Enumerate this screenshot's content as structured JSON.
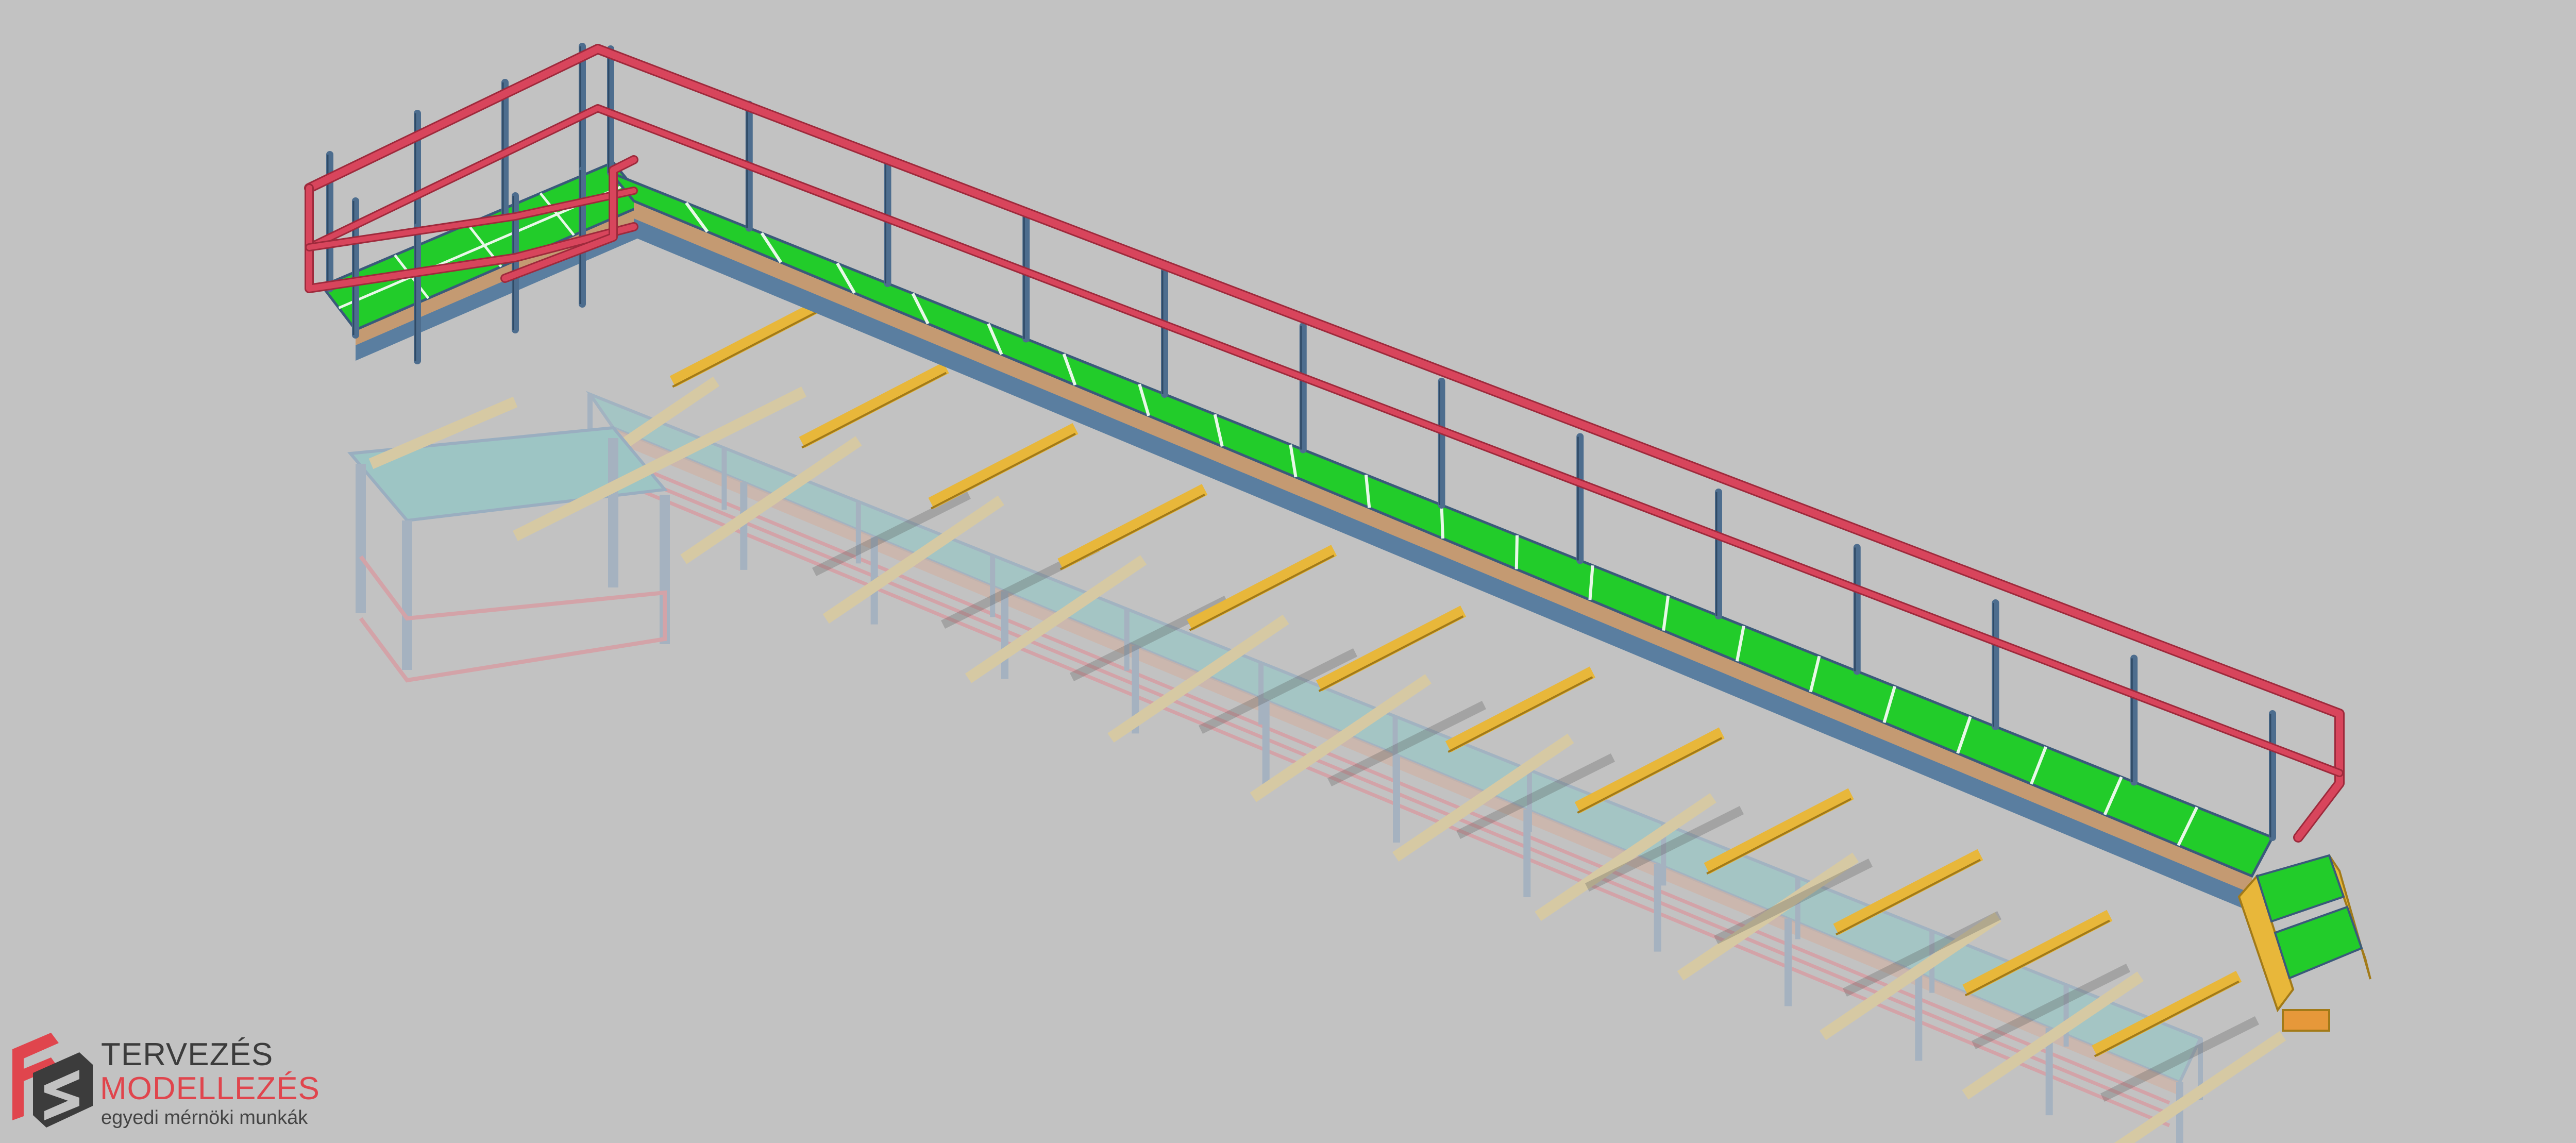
{
  "logo": {
    "line1": "TERVEZÉS",
    "line2": "MODELLEZÉS",
    "line3": "egyedi mérnöki munkák"
  },
  "colors": {
    "background": "#c2c2c2",
    "railing": "#d8455c",
    "post": "#4d6d8e",
    "deck": "#22cc2a",
    "deck_edge": "#c49a72",
    "beam": "#e8b73a",
    "logo_red": "#e0454d",
    "logo_dark": "#3c3c3c"
  },
  "icons": {
    "logo_mark": "logo-mark-icon"
  }
}
